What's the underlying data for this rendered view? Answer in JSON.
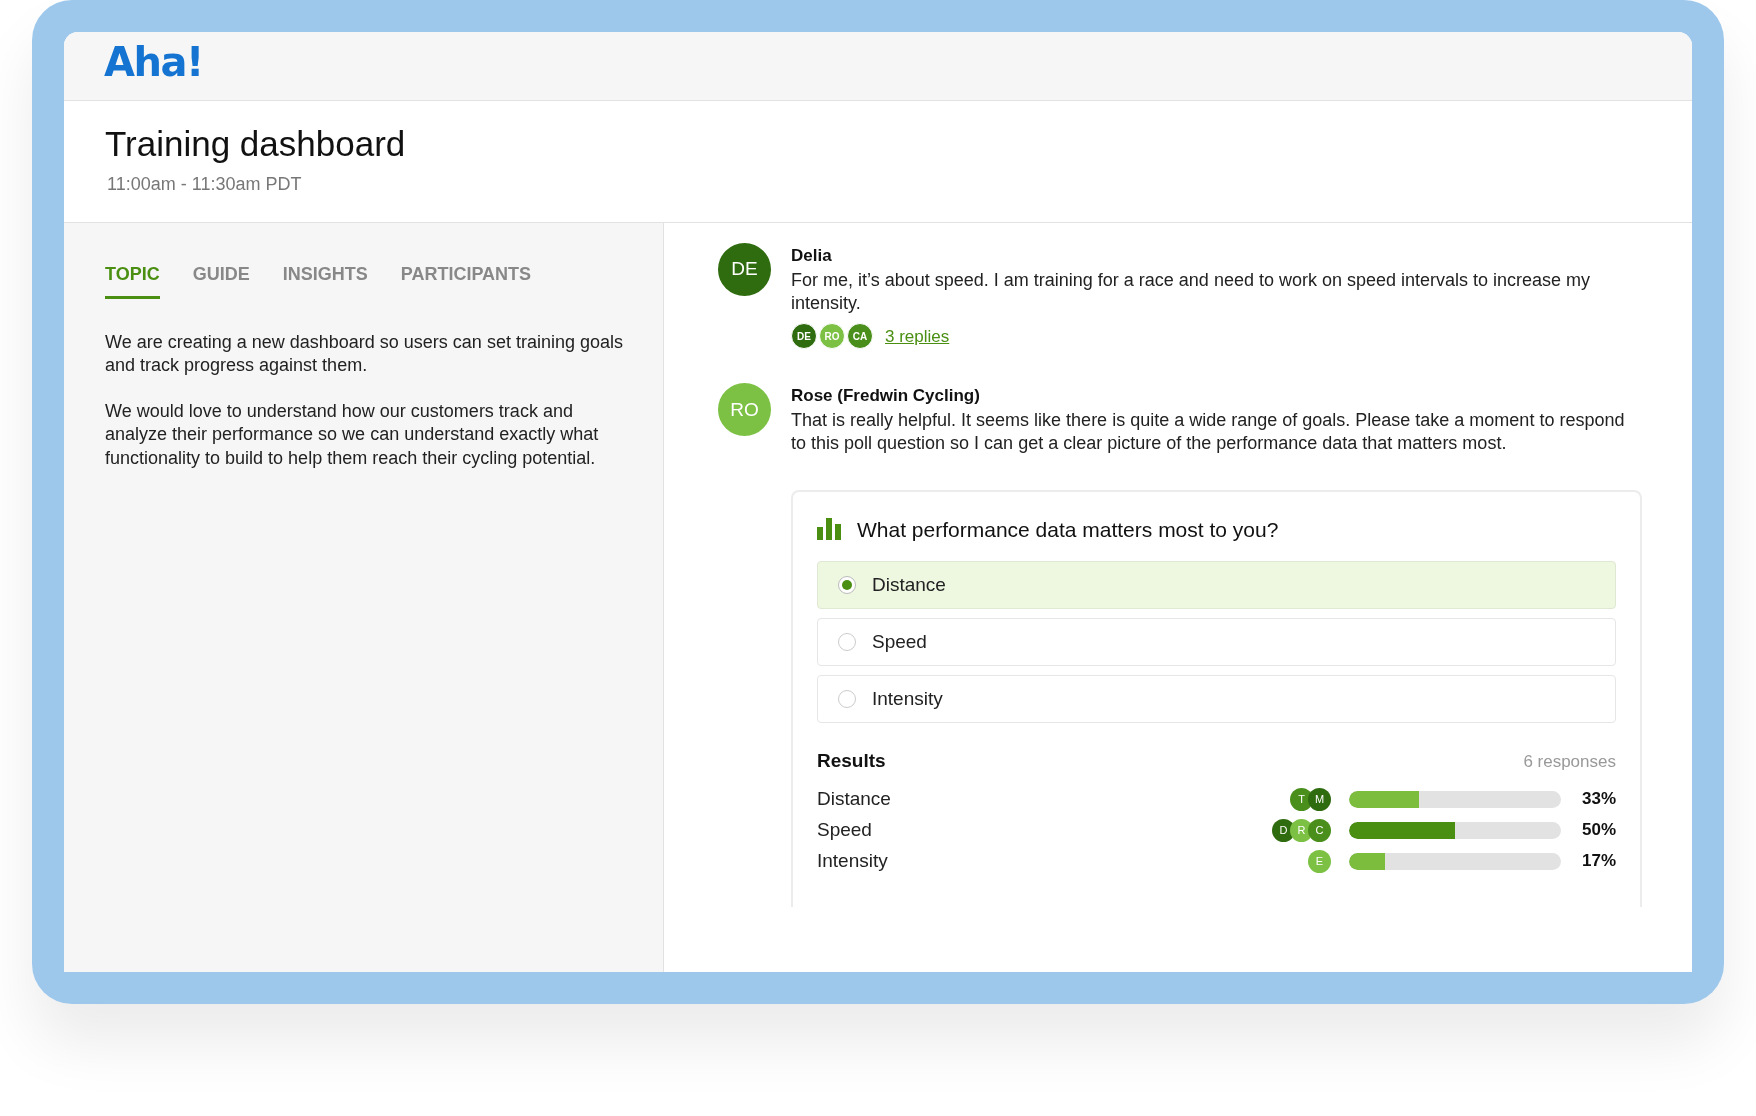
{
  "app": {
    "logo": "Aha!"
  },
  "page": {
    "title": "Training dashboard",
    "time": "11:00am - 11:30am PDT"
  },
  "tabs": [
    {
      "label": "TOPIC",
      "selected": true
    },
    {
      "label": "GUIDE",
      "selected": false
    },
    {
      "label": "INSIGHTS",
      "selected": false
    },
    {
      "label": "PARTICIPANTS",
      "selected": false
    }
  ],
  "topic": {
    "paragraphs": [
      "We are creating a new dashboard so users can set training goals and track progress against them.",
      "We would love to understand how our customers track and analyze their performance so we can understand exactly what functionality to build to help them reach their cycling potential."
    ]
  },
  "messages": [
    {
      "initials": "DE",
      "color": "#2f6b0f",
      "author": "Delia",
      "text": "For me, it’s about speed. I am training for a race and need to work on speed intervals to increase my intensity.",
      "reply_avatars": [
        {
          "initials": "DE",
          "color": "#2f6b0f"
        },
        {
          "initials": "RO",
          "color": "#7cc144"
        },
        {
          "initials": "CA",
          "color": "#4a8f1c"
        }
      ],
      "replies": "3 replies"
    },
    {
      "initials": "RO",
      "color": "#7cc144",
      "author": "Rose (Fredwin Cycling)",
      "text": "That is really helpful. It seems like there is quite a wide range of goals. Please take a moment to respond to this poll question so I can get a clear picture of the performance data that matters most."
    }
  ],
  "poll": {
    "question": "What performance data matters most to you?",
    "options": [
      {
        "label": "Distance",
        "selected": true
      },
      {
        "label": "Speed",
        "selected": false
      },
      {
        "label": "Intensity",
        "selected": false
      }
    ],
    "results_title": "Results",
    "responses": "6 responses",
    "results": [
      {
        "label": "Distance",
        "voters": [
          {
            "initials": "T",
            "color": "#4a8f1c"
          },
          {
            "initials": "M",
            "color": "#2f6b0f"
          }
        ],
        "level": 0.33,
        "color": "#7cbd3e",
        "reading": "33%"
      },
      {
        "label": "Speed",
        "voters": [
          {
            "initials": "D",
            "color": "#2f6b0f"
          },
          {
            "initials": "R",
            "color": "#7cc144"
          },
          {
            "initials": "C",
            "color": "#4a8f1c"
          }
        ],
        "level": 0.5,
        "color": "#4a8f12",
        "reading": "50%"
      },
      {
        "label": "Intensity",
        "voters": [
          {
            "initials": "E",
            "color": "#7cc144"
          }
        ],
        "level": 0.17,
        "color": "#7cbd3e",
        "reading": "17%"
      }
    ]
  }
}
